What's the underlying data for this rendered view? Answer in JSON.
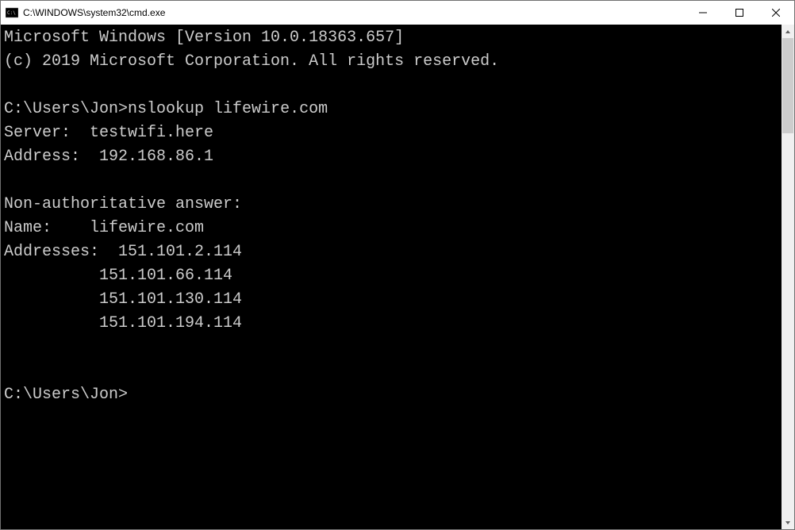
{
  "window": {
    "title": "C:\\WINDOWS\\system32\\cmd.exe"
  },
  "terminal": {
    "banner_version": "Microsoft Windows [Version 10.0.18363.657]",
    "banner_copyright": "(c) 2019 Microsoft Corporation. All rights reserved.",
    "prompt1": "C:\\Users\\Jon>",
    "command": "nslookup lifewire.com",
    "server_line": "Server:  testwifi.here",
    "address_line": "Address:  192.168.86.1",
    "nonauth_line": "Non-authoritative answer:",
    "name_line": "Name:    lifewire.com",
    "addresses_label": "Addresses:  151.101.2.114",
    "addr2": "          151.101.66.114",
    "addr3": "          151.101.130.114",
    "addr4": "          151.101.194.114",
    "prompt2": "C:\\Users\\Jon>"
  }
}
